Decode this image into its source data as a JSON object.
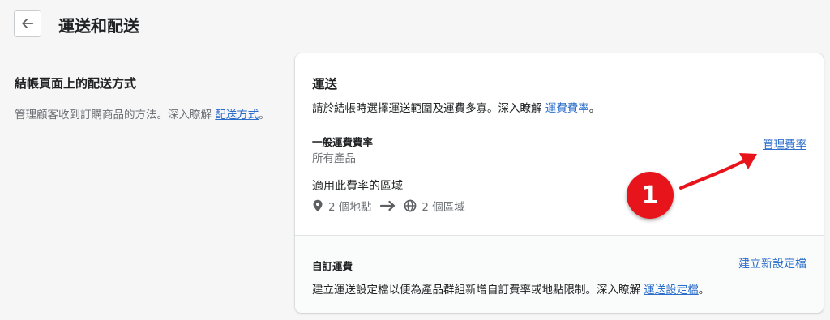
{
  "header": {
    "title": "運送和配送",
    "back_icon": "arrow-left-icon"
  },
  "left": {
    "title": "結帳頁面上的配送方式",
    "desc": "管理顧客收到訂購商品的方法。深入瞭解 ",
    "link": "配送方式",
    "desc_end": "。"
  },
  "card": {
    "title": "運送",
    "desc": "請於結帳時選擇運送範圍及運費多寡。深入瞭解 ",
    "desc_link": "運費費率",
    "desc_end": "。",
    "rate_name": "一般運費費率",
    "rate_sub": "所有產品",
    "manage_link": "管理費率",
    "zone_title": "適用此費率的區域",
    "locations": "2 個地點",
    "zones": "2 個區域",
    "custom_title": "自訂運費",
    "create_link": "建立新設定檔",
    "custom_desc": "建立運送設定檔以便為產品群組新增自訂費率或地點限制。深入瞭解 ",
    "custom_link": "運送設定檔",
    "custom_end": "。"
  },
  "annotation": {
    "number": "1",
    "color": "#e8141b"
  },
  "colors": {
    "link": "#2c6ecb",
    "muted": "#6d7175",
    "background": "#f6f6f7"
  }
}
